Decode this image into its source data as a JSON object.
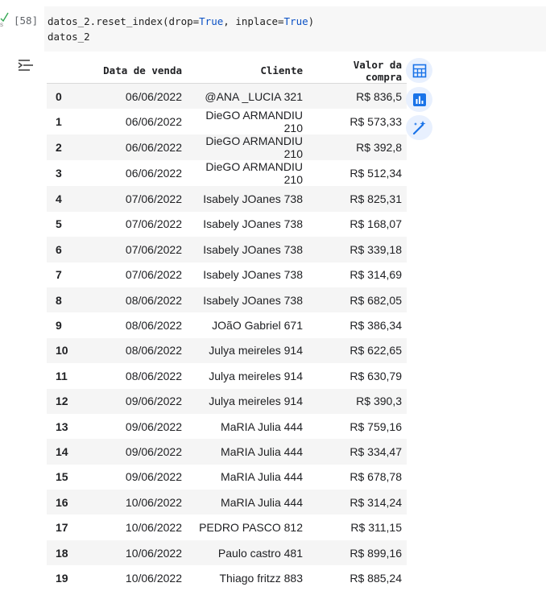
{
  "cell": {
    "execution_count": "[58]",
    "exec_time": "s",
    "code_lines": [
      {
        "pre": "datos_2.reset_index(drop=",
        "kw1": "True",
        "mid": ", inplace=",
        "kw2": "True",
        "post": ")"
      },
      {
        "pre": "datos_2",
        "kw1": "",
        "mid": "",
        "kw2": "",
        "post": ""
      }
    ]
  },
  "table": {
    "columns": [
      "Data de venda",
      "Cliente",
      "Valor da compra"
    ],
    "rows": [
      {
        "index": "0",
        "data": "06/06/2022",
        "cliente": "@ANA _LUCIA 321",
        "valor": "R$ 836,5"
      },
      {
        "index": "1",
        "data": "06/06/2022",
        "cliente": "DieGO ARMANDIU 210",
        "valor": "R$ 573,33"
      },
      {
        "index": "2",
        "data": "06/06/2022",
        "cliente": "DieGO ARMANDIU 210",
        "valor": "R$ 392,8"
      },
      {
        "index": "3",
        "data": "06/06/2022",
        "cliente": "DieGO ARMANDIU 210",
        "valor": "R$ 512,34"
      },
      {
        "index": "4",
        "data": "07/06/2022",
        "cliente": "Isabely JOanes 738",
        "valor": "R$ 825,31"
      },
      {
        "index": "5",
        "data": "07/06/2022",
        "cliente": "Isabely JOanes 738",
        "valor": "R$ 168,07"
      },
      {
        "index": "6",
        "data": "07/06/2022",
        "cliente": "Isabely JOanes 738",
        "valor": "R$ 339,18"
      },
      {
        "index": "7",
        "data": "07/06/2022",
        "cliente": "Isabely JOanes 738",
        "valor": "R$ 314,69"
      },
      {
        "index": "8",
        "data": "08/06/2022",
        "cliente": "Isabely JOanes 738",
        "valor": "R$ 682,05"
      },
      {
        "index": "9",
        "data": "08/06/2022",
        "cliente": "JOãO Gabriel 671",
        "valor": "R$ 386,34"
      },
      {
        "index": "10",
        "data": "08/06/2022",
        "cliente": "Julya meireles 914",
        "valor": "R$ 622,65"
      },
      {
        "index": "11",
        "data": "08/06/2022",
        "cliente": "Julya meireles 914",
        "valor": "R$ 630,79"
      },
      {
        "index": "12",
        "data": "09/06/2022",
        "cliente": "Julya meireles 914",
        "valor": "R$ 390,3"
      },
      {
        "index": "13",
        "data": "09/06/2022",
        "cliente": "MaRIA Julia 444",
        "valor": "R$ 759,16"
      },
      {
        "index": "14",
        "data": "09/06/2022",
        "cliente": "MaRIA Julia 444",
        "valor": "R$ 334,47"
      },
      {
        "index": "15",
        "data": "09/06/2022",
        "cliente": "MaRIA Julia 444",
        "valor": "R$ 678,78"
      },
      {
        "index": "16",
        "data": "10/06/2022",
        "cliente": "MaRIA Julia 444",
        "valor": "R$ 314,24"
      },
      {
        "index": "17",
        "data": "10/06/2022",
        "cliente": "PEDRO PASCO 812",
        "valor": "R$ 311,15"
      },
      {
        "index": "18",
        "data": "10/06/2022",
        "cliente": "Paulo castro 481",
        "valor": "R$ 899,16"
      },
      {
        "index": "19",
        "data": "10/06/2022",
        "cliente": "Thiago fritzz 883",
        "valor": "R$ 885,24"
      }
    ]
  },
  "side_actions": [
    {
      "icon": "table-icon"
    },
    {
      "icon": "bar-chart-icon"
    },
    {
      "icon": "magic-wand-icon"
    }
  ],
  "colors": {
    "keyword": "#0b51c5",
    "accent": "#1a73e8",
    "success": "#34a853"
  }
}
